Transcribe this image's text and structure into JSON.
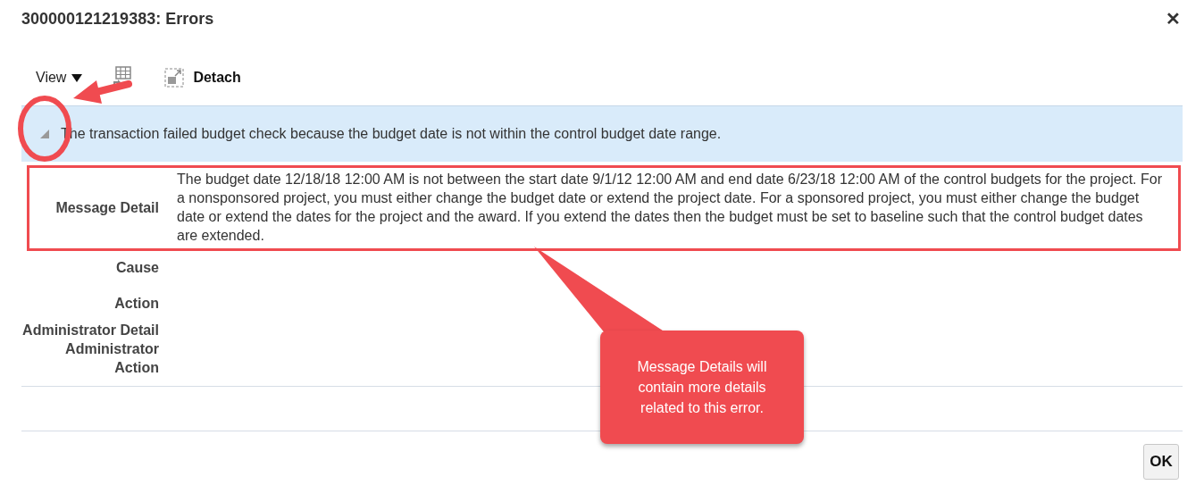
{
  "dialog": {
    "title": "300000121219383: Errors",
    "close": "✕"
  },
  "toolbar": {
    "view_menu": "View",
    "detach": "Detach"
  },
  "error": {
    "expanded": true,
    "message": "The transaction failed budget check because the budget date is not within the control budget date range.",
    "details": [
      {
        "label": "Message Detail",
        "value": "The budget date 12/18/18 12:00 AM is not between the start date 9/1/12 12:00 AM and end date 6/23/18 12:00 AM of the control budgets for the project. For a nonsponsored project, you must either change the budget date or extend the project date. For a sponsored project, you must either change the budget date or extend the dates for the project and the award. If you extend the dates then the budget must be set to baseline such that the control budget dates are extended.",
        "highlighted": true
      },
      {
        "label": "Cause",
        "highlighted": false
      },
      {
        "label": "Action",
        "highlighted": false
      },
      {
        "label": "Administrator Detail",
        "highlighted": false
      },
      {
        "label": "Administrator Action",
        "highlighted": false
      }
    ]
  },
  "callout": {
    "text": "Message Details will contain more details related to this error."
  },
  "buttons": [
    "OK"
  ]
}
